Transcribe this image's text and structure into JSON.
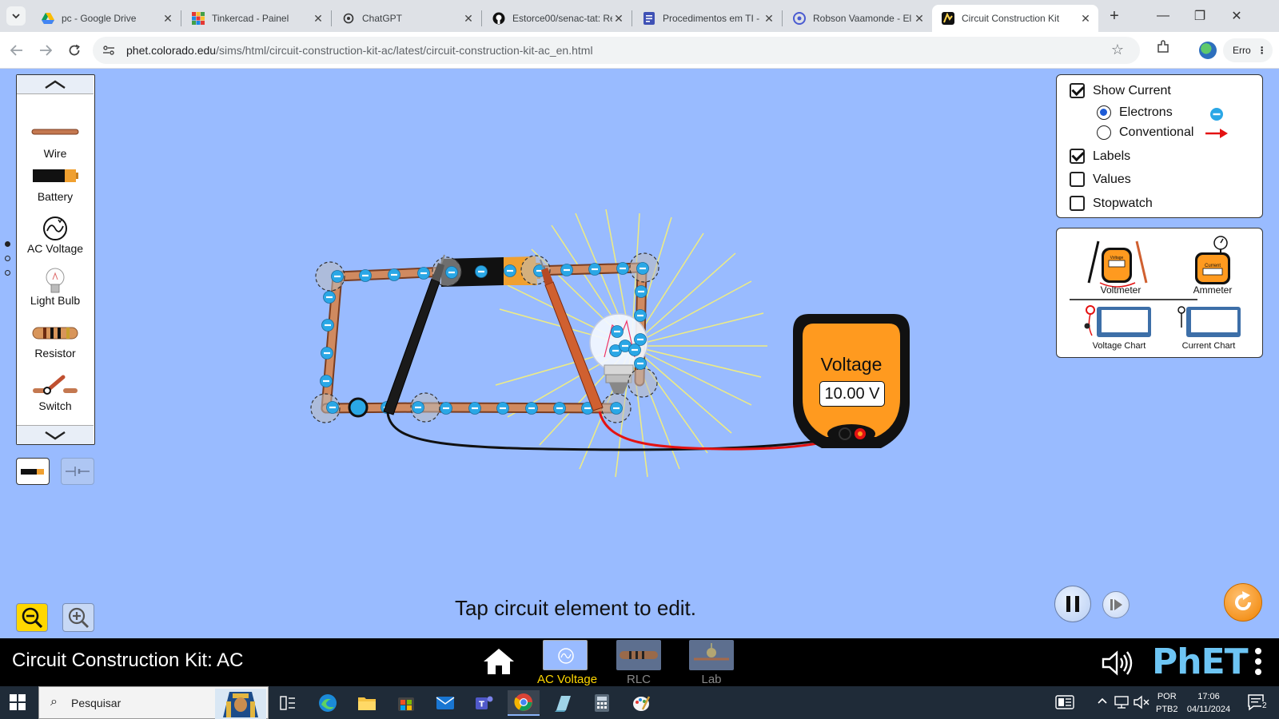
{
  "browser": {
    "tabs": [
      {
        "title": "pc - Google Drive",
        "icon": "google-drive-icon"
      },
      {
        "title": "Tinkercad - Painel",
        "icon": "tinkercad-icon"
      },
      {
        "title": "ChatGPT",
        "icon": "chatgpt-icon"
      },
      {
        "title": "Estorce00/senac-tat: Re",
        "icon": "github-icon"
      },
      {
        "title": "Procedimentos em TI -",
        "icon": "forms-icon"
      },
      {
        "title": "Robson Vaamonde - El",
        "icon": "blogger-icon"
      },
      {
        "title": "Circuit Construction Kit",
        "icon": "phet-icon",
        "active": true
      }
    ],
    "url_domain": "phet.colorado.edu",
    "url_path": "/sims/html/circuit-construction-kit-ac/latest/circuit-construction-kit-ac_en.html",
    "profile_chip": "Erro"
  },
  "carousel": {
    "items": [
      {
        "label": "Wire"
      },
      {
        "label": "Battery"
      },
      {
        "label": "AC Voltage"
      },
      {
        "label": "Light Bulb"
      },
      {
        "label": "Resistor"
      },
      {
        "label": "Switch"
      }
    ]
  },
  "display_panel": {
    "show_current": {
      "label": "Show Current",
      "checked": true
    },
    "electrons": {
      "label": "Electrons",
      "selected": true
    },
    "conventional": {
      "label": "Conventional",
      "selected": false
    },
    "labels": {
      "label": "Labels",
      "checked": true
    },
    "values": {
      "label": "Values",
      "checked": false
    },
    "stopwatch": {
      "label": "Stopwatch",
      "checked": false
    }
  },
  "tools_panel": {
    "voltmeter": "Voltmeter",
    "ammeter": "Ammeter",
    "voltage_chart": "Voltage Chart",
    "current_chart": "Current Chart",
    "voltmeter_icon_text": "Voltage",
    "ammeter_icon_text": "Current"
  },
  "voltmeter": {
    "title": "Voltage",
    "reading": "10.00 V"
  },
  "status_text": "Tap circuit element to edit.",
  "navbar": {
    "sim_title": "Circuit Construction Kit: AC",
    "screens": [
      {
        "label": "AC Voltage",
        "active": true
      },
      {
        "label": "RLC",
        "active": false
      },
      {
        "label": "Lab",
        "active": false
      }
    ],
    "logo": "PhET"
  },
  "taskbar": {
    "search_placeholder": "Pesquisar",
    "lang_top": "POR",
    "lang_bottom": "PTB2",
    "time": "17:06",
    "date": "04/11/2024",
    "notification_count": "2"
  },
  "colors": {
    "sim_background": "#99bbff",
    "meter_orange": "#ff9a1f",
    "electron_blue": "#2aa7e6",
    "wire_copper": "#c47850",
    "active_screen_label": "#ffd700",
    "phet_blue": "#6dc5f4"
  }
}
